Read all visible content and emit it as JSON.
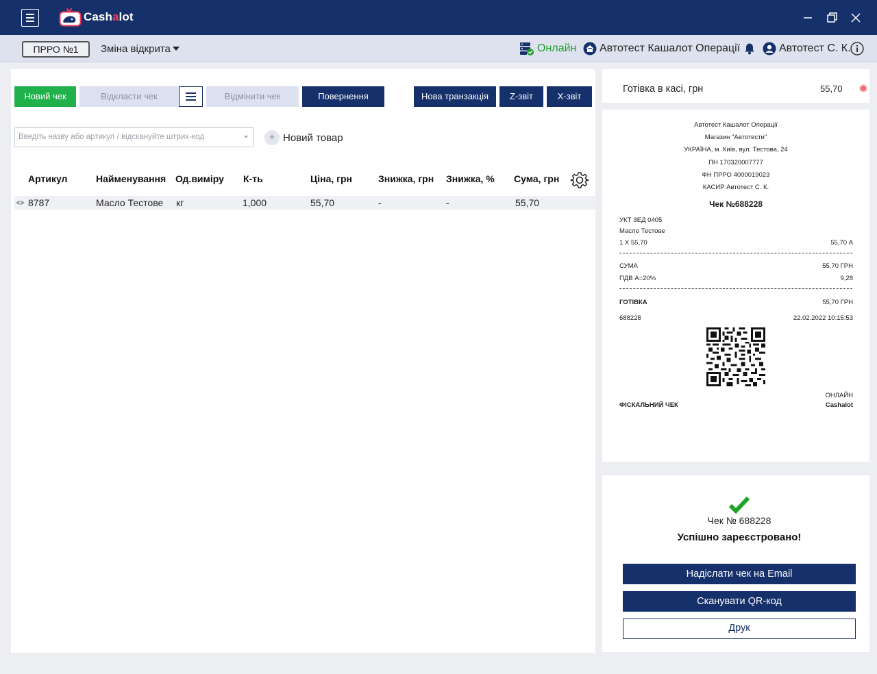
{
  "app": {
    "logo_text_a": "Cash",
    "logo_text_b": "a",
    "logo_text_c": "lot"
  },
  "subbar": {
    "prro_label": "ПРРО №1",
    "shift_label": "Зміна відкрита",
    "online_label": "Онлайн",
    "org_label": "Автотест Кашалот Операції",
    "user_label": "Автотест С. К."
  },
  "toolbar": {
    "new_check": "Новий чек",
    "postpone": "Відкласти чек",
    "cancel": "Відмінити чек",
    "return": "Повернення",
    "new_transaction": "Нова транзакція",
    "z_report": "Z-звіт",
    "x_report": "X-звіт"
  },
  "search": {
    "placeholder": "Введіть назву або артикул / відскануйте штрих-код"
  },
  "new_item_label": "Новий товар",
  "table": {
    "headers": [
      "Артикул",
      "Найменування",
      "Од.виміру",
      "К-ть",
      "Ціна, грн",
      "Знижка, грн",
      "Знижка, %",
      "Сума, грн"
    ],
    "rows": [
      {
        "article": "8787",
        "name": "Масло Тестове",
        "unit": "кг",
        "qty": "1,000",
        "price": "55,70",
        "discount": "-",
        "discount_pct": "-",
        "sum": "55,70"
      }
    ]
  },
  "cash": {
    "label": "Готівка в касі, грн",
    "value": "55,70"
  },
  "receipt": {
    "header_lines": [
      "Автотест Кашалот Операції",
      "Магазин \"Автотести\"",
      "УКРАЇНА, м. Київ, вул. Тестова, 24",
      "ПН 170320007777",
      "ФН ПРРО 4000019023",
      "КАСИР Автотест С. К."
    ],
    "title": "Чек №688228",
    "item_code": "УКТ ЗЕД 0405",
    "item_name": "Масло Тестове",
    "item_qty": "1 X 55,70",
    "item_sum": "55,70 А",
    "sum_label": "СУМА",
    "sum_value": "55,70 ГРН",
    "vat_label": "ПДВ А=20%",
    "vat_value": "9,28",
    "cash_label": "ГОТІВКА",
    "cash_value": "55,70 ГРН",
    "number": "688228",
    "datetime": "22.02.2022 10:15:53",
    "fiscal_label": "ФІСКАЛЬНИЙ ЧЕК",
    "online_label": "ОНЛАЙН",
    "brand_label": "Cashalot"
  },
  "success": {
    "check_number": "Чек № 688228",
    "message": "Успішно зареєстровано!",
    "email_button": "Надіслати чек на Email",
    "qr_button": "Сканувати QR-код",
    "print_button": "Друк"
  },
  "colors": {
    "navy": "#16306b",
    "green": "#21b14b",
    "online": "#1f9d2a",
    "accent": "#ef3b5c"
  }
}
